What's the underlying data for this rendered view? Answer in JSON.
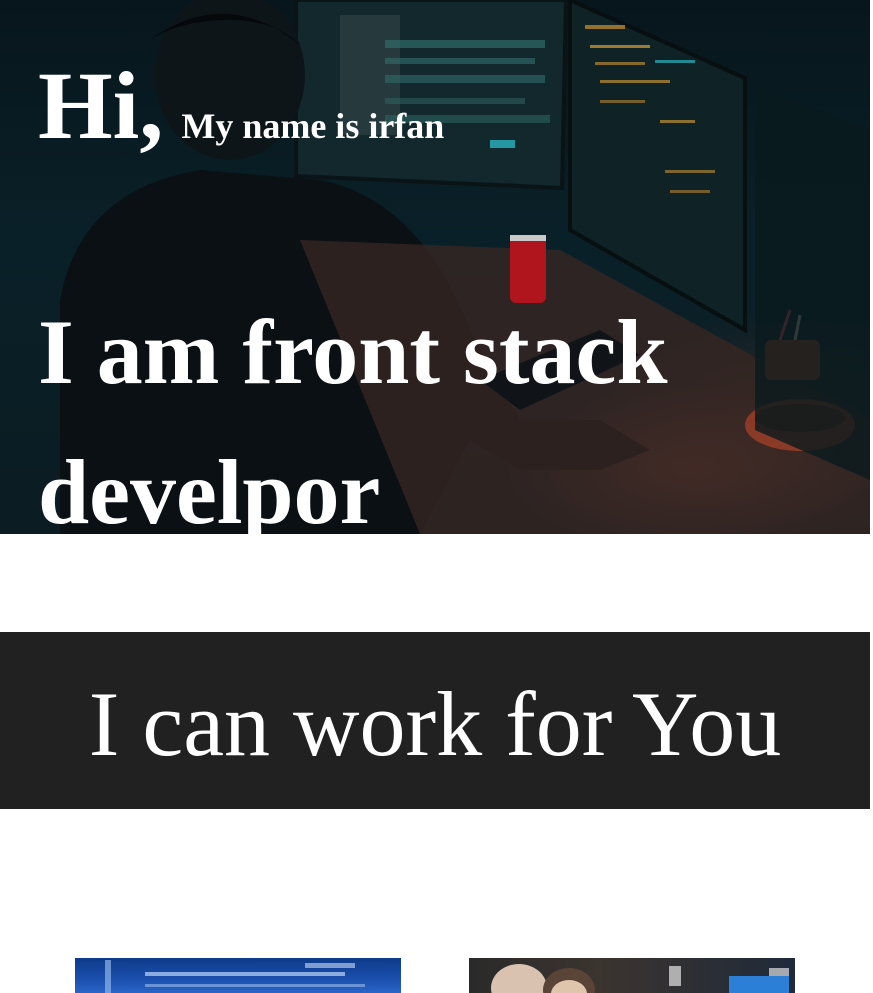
{
  "hero": {
    "greeting": "Hi,",
    "name_line": "My name is irfan",
    "headline": "I am front stack develpor",
    "background_image": "developer-at-desk-photo"
  },
  "services": {
    "title": "I can work for You"
  },
  "cards": [
    {
      "image": "server-room-photo"
    },
    {
      "image": "team-at-computers-photo"
    }
  ],
  "colors": {
    "hero_text": "#ffffff",
    "band_background": "#212121",
    "page_background": "#ffffff"
  }
}
